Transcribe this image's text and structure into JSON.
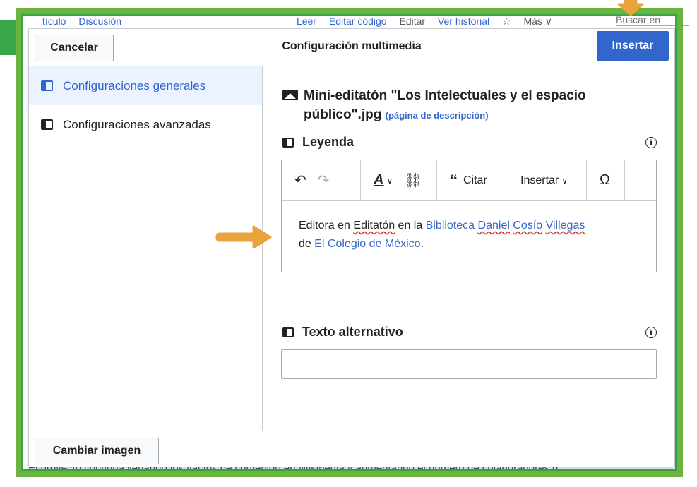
{
  "background": {
    "tabs": [
      "tículo",
      "Discusión",
      "Leer",
      "Editar código",
      "Editar",
      "Ver historial",
      "☆",
      "Más ∨"
    ],
    "search_placeholder": "Buscar en",
    "footer_text": "El proyecto continúa llenando los vacíos de contenido en Wikipedia y aumentando el número de colaboradores d"
  },
  "dialog": {
    "title": "Configuración multimedia",
    "cancel_label": "Cancelar",
    "insert_label": "Insertar",
    "change_image_label": "Cambiar imagen",
    "nav": [
      {
        "label": "Configuraciones generales",
        "active": true
      },
      {
        "label": "Configuraciones avanzadas",
        "active": false
      }
    ],
    "file": {
      "name": "Mini-editatón \"Los Intelectuales y el espacio público\".jpg",
      "description_link": "(página de descripción)"
    },
    "caption": {
      "label": "Leyenda",
      "toolbar": {
        "cite_label": "Citar",
        "insert_label": "Insertar",
        "special_char": "Ω"
      },
      "text_parts": {
        "p1": "Editora en ",
        "w1": "Editatón",
        "p2": " en la ",
        "l1": "Biblioteca",
        "l2": "Daniel",
        "l3": "Cosío",
        "l4": "Villegas",
        "p3": "de ",
        "l5": "El Colegio de México",
        "p4": "."
      }
    },
    "alt_text": {
      "label": "Texto alternativo",
      "value": ""
    }
  },
  "colors": {
    "accent": "#3366cc",
    "frame_green": "#6cb33f",
    "arrow_orange": "#e8a33c"
  }
}
